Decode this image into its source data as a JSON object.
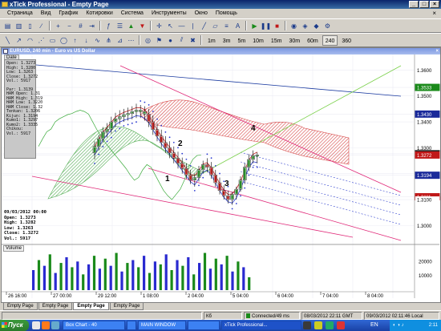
{
  "window": {
    "title": "xTick Professional - Empty Page"
  },
  "menu": [
    "Страница",
    "Вид",
    "График",
    "Котировки",
    "Система",
    "Инструменты",
    "Окно",
    "Помощь"
  ],
  "timeframes": [
    "1m",
    "3m",
    "5m",
    "10m",
    "15m",
    "30m",
    "60m",
    "240",
    "360"
  ],
  "chart": {
    "title": "EURUSD, 240 min - Euro vs US Dollar",
    "date_label": "Date",
    "databox": [
      "Open: 1.3273",
      "High: 1.3280",
      "Low: 1.3263",
      "Close: 1.3272",
      "Vol.: 5917",
      "",
      "Par: 1.3139",
      "HAM Open: 1.31",
      "HAM High: 1.319",
      "HAM Low: 1.3220",
      "HAM Close: 1.32",
      "Tenkan: 1.3206",
      "Kijun: 1.3194",
      "Kumo1: 1.3297",
      "Kumo2: 1.3335",
      "Chikou: ",
      "Vol.: 5917"
    ],
    "ohlc_date": "09/03/2012 00:00",
    "ohlc": [
      "Open: 1.3273",
      "High: 1.3282",
      "Low: 1.3263",
      "Close: 1.3272",
      "Vol.: 5917"
    ],
    "wave_labels": [
      "1",
      "2",
      "3",
      "4"
    ],
    "price_ticks": [
      {
        "label": "1.3600",
        "price": 1.36,
        "fill": "#ffffff"
      },
      {
        "label": "1.3533",
        "price": 1.3533,
        "fill": "#1a8a1a"
      },
      {
        "label": "1.3500",
        "price": 1.35,
        "fill": "#ffffff"
      },
      {
        "label": "1.3430",
        "price": 1.343,
        "fill": "#1a2a9a"
      },
      {
        "label": "1.3400",
        "price": 1.34,
        "fill": "#ffffff"
      },
      {
        "label": "1.3300",
        "price": 1.33,
        "fill": "#ffffff"
      },
      {
        "label": "1.3277",
        "price": 1.3277,
        "fill": "#222222"
      },
      {
        "label": "1.3272",
        "price": 1.3272,
        "fill": "#c01818"
      },
      {
        "label": "1.3200",
        "price": 1.32,
        "fill": "#ffffff"
      },
      {
        "label": "1.3194",
        "price": 1.3194,
        "fill": "#1a2a9a"
      },
      {
        "label": "1.3111",
        "price": 1.3111,
        "fill": "#c01818"
      },
      {
        "label": "1.3100",
        "price": 1.31,
        "fill": "#ffffff"
      },
      {
        "label": "1.3000",
        "price": 1.3,
        "fill": "#ffffff"
      }
    ],
    "price_range": [
      1.293,
      1.366
    ],
    "time_labels": [
      "26 16:00",
      "27 00:00",
      "29 12:00",
      "1 08:00",
      "2 04:00",
      "5 04:00",
      "6 04:00",
      "7 04:00",
      "8 04:00"
    ],
    "volume_label": "Volume",
    "volume_ticks": [
      {
        "label": "20000",
        "v": 20000
      },
      {
        "label": "10000",
        "v": 10000
      }
    ],
    "volume_max": 28000,
    "candles": [
      {
        "o": 1.328,
        "h": 1.3325,
        "l": 1.3255,
        "c": 1.3305,
        "t": "#c8e6c8",
        "b": "#2a8a2a"
      },
      {
        "o": 1.3305,
        "h": 1.335,
        "l": 1.329,
        "c": 1.3335,
        "t": "#c8e6c8",
        "b": "#2a8a2a"
      },
      {
        "o": 1.3335,
        "h": 1.338,
        "l": 1.332,
        "c": 1.3362,
        "t": "#c8e6c8",
        "b": "#2a8a2a"
      },
      {
        "o": 1.3362,
        "h": 1.3395,
        "l": 1.334,
        "c": 1.3372,
        "t": "#c8e6c8",
        "b": "#2a8a2a"
      },
      {
        "o": 1.3372,
        "h": 1.342,
        "l": 1.3355,
        "c": 1.34,
        "t": "#c8e6c8",
        "b": "#2a8a2a"
      },
      {
        "o": 1.34,
        "h": 1.3435,
        "l": 1.338,
        "c": 1.3412,
        "t": "#c8e6c8",
        "b": "#2a8a2a"
      },
      {
        "o": 1.3412,
        "h": 1.3445,
        "l": 1.339,
        "c": 1.342,
        "t": "#c8e6c8",
        "b": "#2a8a2a"
      },
      {
        "o": 1.342,
        "h": 1.345,
        "l": 1.34,
        "c": 1.3428,
        "t": "#c8e6c8",
        "b": "#2a8a2a"
      },
      {
        "o": 1.3428,
        "h": 1.3455,
        "l": 1.3405,
        "c": 1.3432,
        "t": "#c8e6c8",
        "b": "#2a8a2a"
      },
      {
        "o": 1.3432,
        "h": 1.346,
        "l": 1.341,
        "c": 1.344,
        "t": "#c8e6c8",
        "b": "#2a8a2a"
      },
      {
        "o": 1.344,
        "h": 1.347,
        "l": 1.3415,
        "c": 1.3445,
        "t": "#c8e6c8",
        "b": "#2a8a2a"
      },
      {
        "o": 1.3445,
        "h": 1.3465,
        "l": 1.3415,
        "c": 1.344,
        "t": "#c8e6c8",
        "b": "#2a8a2a"
      },
      {
        "o": 1.344,
        "h": 1.346,
        "l": 1.3405,
        "c": 1.343,
        "t": "#c8e6c8",
        "b": "#2a8a2a"
      },
      {
        "o": 1.343,
        "h": 1.345,
        "l": 1.338,
        "c": 1.34,
        "t": "#f0c0c0",
        "b": "#b01818"
      },
      {
        "o": 1.34,
        "h": 1.3425,
        "l": 1.335,
        "c": 1.337,
        "t": "#f0c0c0",
        "b": "#b01818"
      },
      {
        "o": 1.337,
        "h": 1.3395,
        "l": 1.3325,
        "c": 1.3345,
        "t": "#f0c0c0",
        "b": "#b01818"
      },
      {
        "o": 1.3345,
        "h": 1.337,
        "l": 1.33,
        "c": 1.332,
        "t": "#f0c0c0",
        "b": "#b01818"
      },
      {
        "o": 1.332,
        "h": 1.3345,
        "l": 1.328,
        "c": 1.33,
        "t": "#f0c0c0",
        "b": "#b01818"
      },
      {
        "o": 1.33,
        "h": 1.3325,
        "l": 1.326,
        "c": 1.328,
        "t": "#f0c0c0",
        "b": "#b01818"
      },
      {
        "o": 1.328,
        "h": 1.3305,
        "l": 1.324,
        "c": 1.326,
        "t": "#f0c0c0",
        "b": "#b01818"
      },
      {
        "o": 1.326,
        "h": 1.3285,
        "l": 1.322,
        "c": 1.324,
        "t": "#f0c0c0",
        "b": "#b01818"
      },
      {
        "o": 1.324,
        "h": 1.3262,
        "l": 1.32,
        "c": 1.322,
        "t": "#f0c0c0",
        "b": "#b01818"
      },
      {
        "o": 1.322,
        "h": 1.324,
        "l": 1.318,
        "c": 1.3195,
        "t": "#f0c0c0",
        "b": "#b01818"
      },
      {
        "o": 1.3195,
        "h": 1.3215,
        "l": 1.316,
        "c": 1.3175,
        "t": "#f0c0c0",
        "b": "#b01818"
      },
      {
        "o": 1.3175,
        "h": 1.32,
        "l": 1.315,
        "c": 1.3185,
        "t": "#c8e6c8",
        "b": "#2a8a2a"
      },
      {
        "o": 1.3185,
        "h": 1.323,
        "l": 1.317,
        "c": 1.3215,
        "t": "#c8e6c8",
        "b": "#2a8a2a"
      },
      {
        "o": 1.3215,
        "h": 1.325,
        "l": 1.32,
        "c": 1.3235,
        "t": "#c8e6c8",
        "b": "#2a8a2a"
      },
      {
        "o": 1.3235,
        "h": 1.326,
        "l": 1.3205,
        "c": 1.3225,
        "t": "#f0c0c0",
        "b": "#b01818"
      },
      {
        "o": 1.3225,
        "h": 1.3245,
        "l": 1.318,
        "c": 1.3195,
        "t": "#f0c0c0",
        "b": "#b01818"
      },
      {
        "o": 1.3195,
        "h": 1.3215,
        "l": 1.315,
        "c": 1.3165,
        "t": "#f0c0c0",
        "b": "#b01818"
      },
      {
        "o": 1.3165,
        "h": 1.3185,
        "l": 1.312,
        "c": 1.3135,
        "t": "#f0c0c0",
        "b": "#b01818"
      },
      {
        "o": 1.3135,
        "h": 1.3155,
        "l": 1.31,
        "c": 1.3115,
        "t": "#f0c0c0",
        "b": "#b01818"
      },
      {
        "o": 1.3115,
        "h": 1.3135,
        "l": 1.3085,
        "c": 1.31,
        "t": "#f0c0c0",
        "b": "#b01818"
      },
      {
        "o": 1.31,
        "h": 1.313,
        "l": 1.308,
        "c": 1.312,
        "t": "#c8e6c8",
        "b": "#2a8a2a"
      },
      {
        "o": 1.312,
        "h": 1.315,
        "l": 1.31,
        "c": 1.314,
        "t": "#c8e6c8",
        "b": "#2a8a2a"
      },
      {
        "o": 1.314,
        "h": 1.319,
        "l": 1.313,
        "c": 1.3175,
        "t": "#c8e6c8",
        "b": "#2a8a2a"
      },
      {
        "o": 1.3175,
        "h": 1.324,
        "l": 1.316,
        "c": 1.3225,
        "t": "#c8e6c8",
        "b": "#2a8a2a"
      },
      {
        "o": 1.3225,
        "h": 1.3275,
        "l": 1.321,
        "c": 1.3255,
        "t": "#c8e6c8",
        "b": "#2a8a2a"
      },
      {
        "o": 1.3255,
        "h": 1.329,
        "l": 1.324,
        "c": 1.327,
        "t": "#c8e6c8",
        "b": "#2a8a2a"
      },
      {
        "o": 1.327,
        "h": 1.3282,
        "l": 1.324,
        "c": 1.3272,
        "t": "#c8e6c8",
        "b": "#2a8a2a"
      }
    ],
    "volumes": [
      14000,
      21000,
      17000,
      25000,
      12000,
      19000,
      23000,
      16000,
      20000,
      11000,
      18000,
      24000,
      15000,
      22000,
      17000,
      26000,
      13000,
      19000,
      21000,
      16000,
      24000,
      12000,
      20000,
      18000,
      25000,
      14000,
      21000,
      17000,
      23000,
      11000,
      19000,
      26000,
      15000,
      22000,
      18000,
      24000,
      13000,
      20000,
      16000,
      9000
    ]
  },
  "tabs": [
    "Empty Page",
    "Empty Page",
    "Empty Page",
    "Empty Page"
  ],
  "status": {
    "kb": "Кб",
    "connection": "Connected/49 ms",
    "server_time": "08/03/2012 22:11 GMT",
    "local_time": "09/03/2012 02:11:46 Local"
  },
  "taskbar": {
    "start": "Пуск",
    "tasks": [
      "Box Chart - 40",
      "",
      "MAIN WINDOW",
      "",
      "xTick Professional..."
    ],
    "lang": "EN",
    "clock": "2:11"
  }
}
